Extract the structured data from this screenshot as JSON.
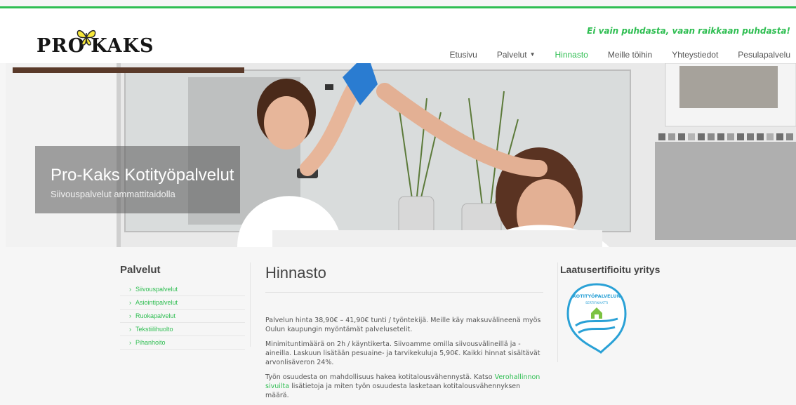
{
  "header": {
    "logo_text": "PROKAKS",
    "logo_alt": "PRO KAKS",
    "slogan": "Ei vain puhdasta, vaan raikkaan puhdasta!"
  },
  "nav": {
    "items": [
      {
        "label": "Etusivu",
        "active": false
      },
      {
        "label": "Palvelut",
        "active": false,
        "has_dropdown": true
      },
      {
        "label": "Hinnasto",
        "active": true
      },
      {
        "label": "Meille töihin",
        "active": false
      },
      {
        "label": "Yhteystiedot",
        "active": false
      },
      {
        "label": "Pesulapalvelu",
        "active": false
      }
    ]
  },
  "hero": {
    "title": "Pro-Kaks Kotityöpalvelut",
    "subtitle": "Siivouspalvelut ammattitaidolla"
  },
  "sidebar": {
    "title": "Palvelut",
    "items": [
      {
        "label": "Siivouspalvelut"
      },
      {
        "label": "Asiointipalvelut"
      },
      {
        "label": "Ruokapalvelut"
      },
      {
        "label": "Tekstiilihuolto"
      },
      {
        "label": "Pihanhoito"
      }
    ]
  },
  "main": {
    "title": "Hinnasto",
    "p1": "Palvelun hinta 38,90€ – 41,90€ tunti / työntekijä. Meille käy maksuvälineenä myös Oulun kaupungin myöntämät palvelusetelit.",
    "p2": "Minimituntimäärä on 2h / käyntikerta. Siivoamme omilla siivousvälineillä ja -aineilla. Laskuun lisätään pesuaine- ja tarvikekuluja 5,90€. Kaikki hinnat sisältävät arvonlisäveron 24%.",
    "p3_before": "Työn osuudesta on mahdollisuus hakea kotitalousvähennystä. Katso",
    "p3_link": "Verohallinnon sivuilta",
    "p3_after": "lisätietoja ja miten työn osuudesta lasketaan kotitalousvähennyksen määrä."
  },
  "right": {
    "title": "Laatusertifioitu yritys",
    "badge_text": "KOTITYÖPALVELUN",
    "badge_subtext": "SERTIFIKAATTI"
  },
  "colors": {
    "accent": "#2fbe52",
    "badge": "#2aa1d6"
  }
}
